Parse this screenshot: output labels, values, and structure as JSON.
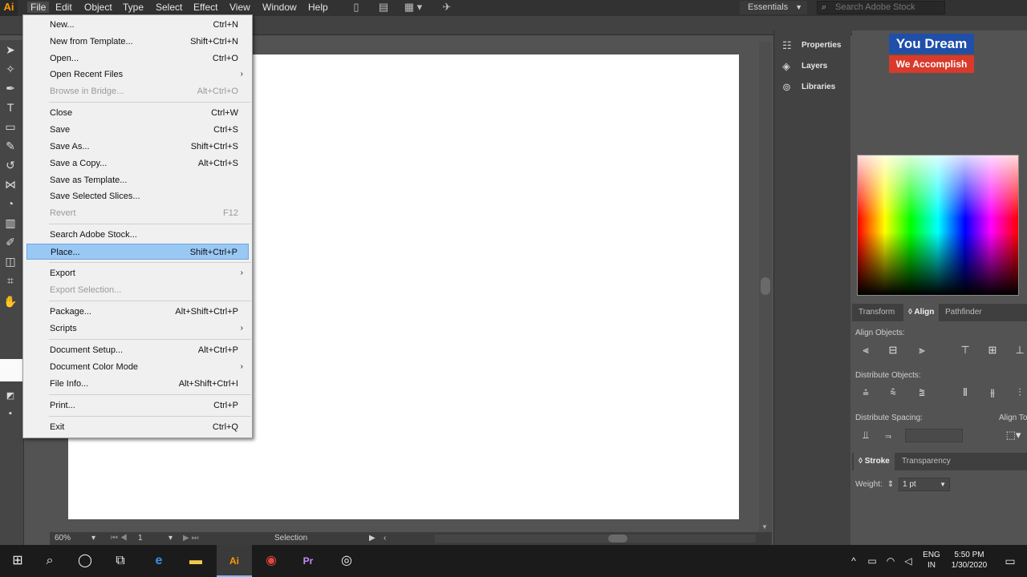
{
  "app": {
    "logo": "Ai"
  },
  "menubar": {
    "items": [
      "File",
      "Edit",
      "Object",
      "Type",
      "Select",
      "Effect",
      "View",
      "Window",
      "Help"
    ],
    "workspace": "Essentials",
    "search_placeholder": "Search Adobe Stock"
  },
  "file_menu": {
    "items": [
      {
        "label": "New...",
        "shortcut": "Ctrl+N"
      },
      {
        "label": "New from Template...",
        "shortcut": "Shift+Ctrl+N"
      },
      {
        "label": "Open...",
        "shortcut": "Ctrl+O"
      },
      {
        "label": "Open Recent Files",
        "shortcut": "",
        "submenu": true
      },
      {
        "label": "Browse in Bridge...",
        "shortcut": "Alt+Ctrl+O",
        "disabled": true
      },
      {
        "label": "Close",
        "shortcut": "Ctrl+W"
      },
      {
        "label": "Save",
        "shortcut": "Ctrl+S"
      },
      {
        "label": "Save As...",
        "shortcut": "Shift+Ctrl+S"
      },
      {
        "label": "Save a Copy...",
        "shortcut": "Alt+Ctrl+S"
      },
      {
        "label": "Save as Template...",
        "shortcut": ""
      },
      {
        "label": "Save Selected Slices...",
        "shortcut": ""
      },
      {
        "label": "Revert",
        "shortcut": "F12",
        "disabled": true
      },
      {
        "label": "Search Adobe Stock...",
        "shortcut": ""
      },
      {
        "label": "Place...",
        "shortcut": "Shift+Ctrl+P",
        "highlighted": true
      },
      {
        "label": "Export",
        "shortcut": "",
        "submenu": true
      },
      {
        "label": "Export Selection...",
        "shortcut": "",
        "disabled": true
      },
      {
        "label": "Package...",
        "shortcut": "Alt+Shift+Ctrl+P"
      },
      {
        "label": "Scripts",
        "shortcut": "",
        "submenu": true
      },
      {
        "label": "Document Setup...",
        "shortcut": "Alt+Ctrl+P"
      },
      {
        "label": "Document Color Mode",
        "shortcut": "",
        "submenu": true
      },
      {
        "label": "File Info...",
        "shortcut": "Alt+Shift+Ctrl+I"
      },
      {
        "label": "Print...",
        "shortcut": "Ctrl+P"
      },
      {
        "label": "Exit",
        "shortcut": "Ctrl+Q"
      }
    ]
  },
  "dock": {
    "items": [
      {
        "label": "Properties",
        "icon": "properties-icon"
      },
      {
        "label": "Layers",
        "icon": "layers-icon"
      },
      {
        "label": "Libraries",
        "icon": "libraries-icon"
      }
    ]
  },
  "banner": {
    "line1": "You Dream",
    "line2": "We Accomplish"
  },
  "align_panel": {
    "tabs": [
      "Transform",
      "Align",
      "Pathfinder"
    ],
    "active_tab": "Align",
    "align_objects": "Align Objects:",
    "distribute_objects": "Distribute Objects:",
    "distribute_spacing": "Distribute Spacing:",
    "align_to": "Align To:"
  },
  "stroke_panel": {
    "tabs": [
      "Stroke",
      "Transparency"
    ],
    "weight_label": "Weight:",
    "weight_value": "1 pt"
  },
  "statusbar": {
    "zoom": "60%",
    "artboard": "1",
    "tool": "Selection"
  },
  "taskbar": {
    "lang": "ENG",
    "region": "IN",
    "time": "5:50 PM",
    "date": "1/30/2020"
  },
  "colors": {
    "menu_highlight": "#99c8f5",
    "banner_blue": "#1f4fa8",
    "banner_red": "#d93a2b",
    "ai_orange": "#ff9a00"
  }
}
